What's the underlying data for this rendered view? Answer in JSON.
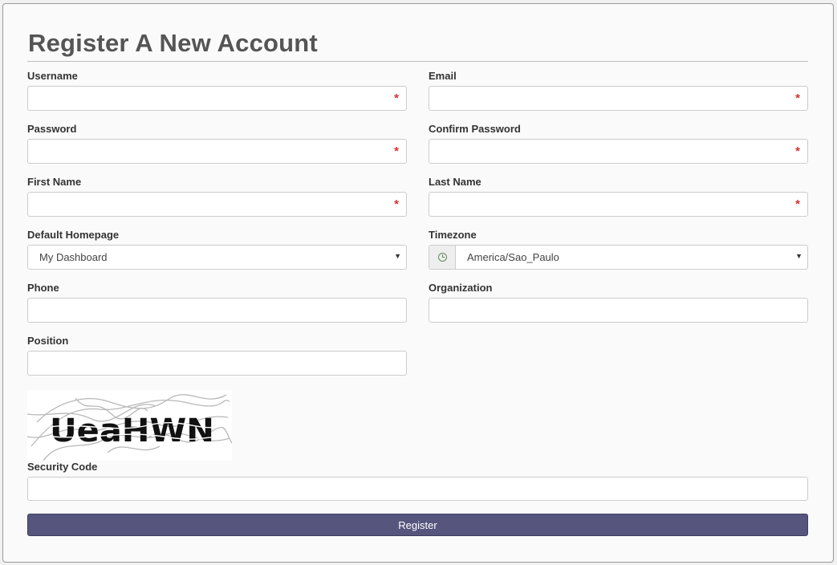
{
  "page": {
    "title": "Register A New Account"
  },
  "fields": {
    "username": {
      "label": "Username",
      "value": "",
      "required_mark": "*"
    },
    "email": {
      "label": "Email",
      "value": "",
      "required_mark": "*"
    },
    "password": {
      "label": "Password",
      "value": "",
      "required_mark": "*"
    },
    "confirm_password": {
      "label": "Confirm Password",
      "value": "",
      "required_mark": "*"
    },
    "first_name": {
      "label": "First Name",
      "value": "",
      "required_mark": "*"
    },
    "last_name": {
      "label": "Last Name",
      "value": "",
      "required_mark": "*"
    },
    "default_homepage": {
      "label": "Default Homepage",
      "selected": "My Dashboard",
      "caret": "▼"
    },
    "timezone": {
      "label": "Timezone",
      "selected": "America/Sao_Paulo",
      "caret": "▼",
      "icon": "clock-icon"
    },
    "phone": {
      "label": "Phone",
      "value": ""
    },
    "organization": {
      "label": "Organization",
      "value": ""
    },
    "position": {
      "label": "Position",
      "value": ""
    },
    "security_code": {
      "label": "Security Code",
      "value": ""
    }
  },
  "captcha": {
    "text": "UeaHWN"
  },
  "actions": {
    "register_label": "Register"
  },
  "colors": {
    "required": "#d9302c",
    "button": "#56557d",
    "title": "#555555"
  }
}
